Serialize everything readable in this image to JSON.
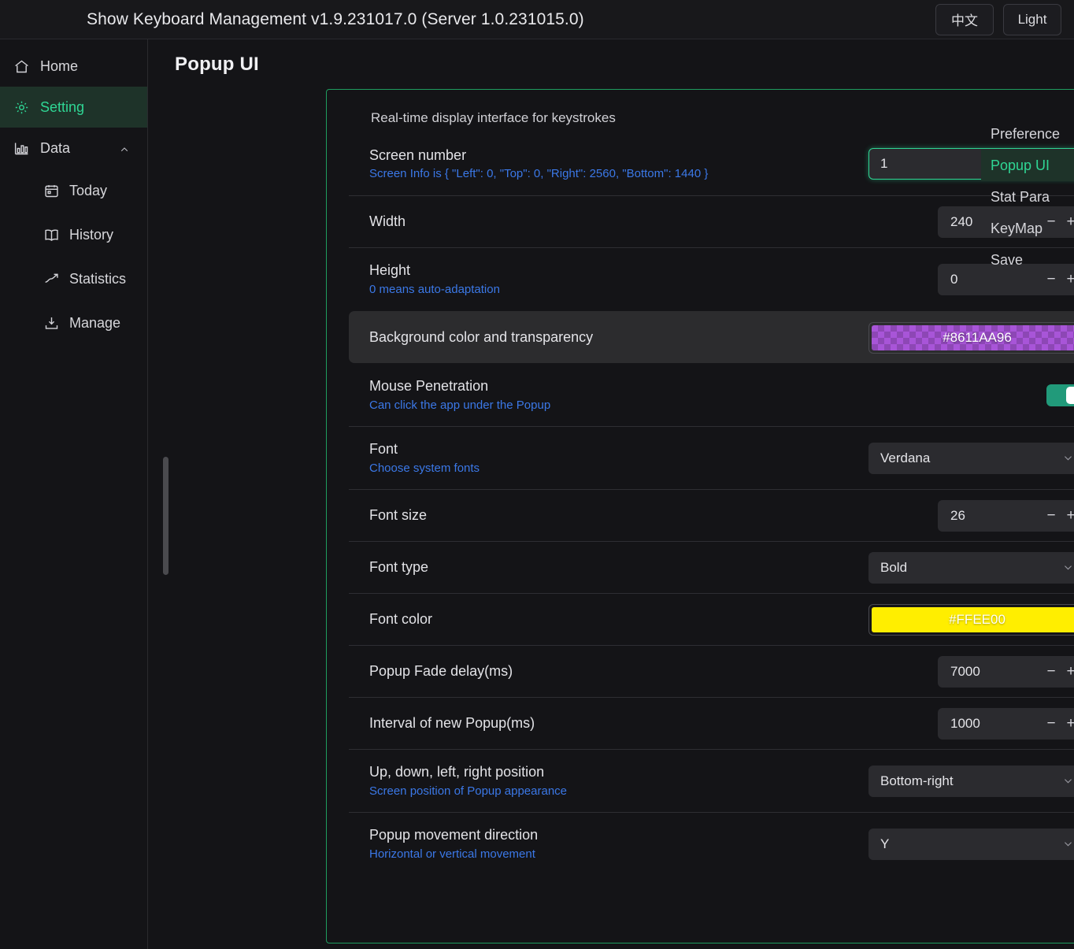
{
  "topbar": {
    "title": "Show Keyboard Management v1.9.231017.0 (Server 1.0.231015.0)",
    "lang_button": "中文",
    "theme_button": "Light"
  },
  "sidebar": {
    "items": [
      {
        "label": "Home",
        "icon": "home-icon",
        "active": false
      },
      {
        "label": "Setting",
        "icon": "gear-icon",
        "active": true
      },
      {
        "label": "Data",
        "icon": "bar-chart-icon",
        "active": false,
        "expanded": true
      },
      {
        "label": "Today",
        "icon": "calendar-icon",
        "sub": true
      },
      {
        "label": "History",
        "icon": "book-icon",
        "sub": true
      },
      {
        "label": "Statistics",
        "icon": "trend-up-icon",
        "sub": true
      },
      {
        "label": "Manage",
        "icon": "download-box-icon",
        "sub": true
      }
    ]
  },
  "rightnav": {
    "items": [
      {
        "label": "Preference",
        "active": false
      },
      {
        "label": "Popup UI",
        "active": true
      },
      {
        "label": "Stat Para",
        "active": false
      },
      {
        "label": "KeyMap",
        "active": false
      },
      {
        "label": "Save",
        "active": false
      }
    ]
  },
  "main": {
    "page_title": "Popup UI",
    "card_subtitle": "Real-time display interface for keystrokes",
    "rows": [
      {
        "name": "screen-number",
        "label": "Screen number",
        "hint": "Screen Info is { \"Left\": 0, \"Top\": 0, \"Right\": 2560, \"Bottom\": 1440 }",
        "control": "select",
        "value": "1",
        "focused": true
      },
      {
        "name": "width",
        "label": "Width",
        "hint": "",
        "control": "stepper",
        "value": "240"
      },
      {
        "name": "height",
        "label": "Height",
        "hint": "0 means auto-adaptation",
        "control": "stepper",
        "value": "0"
      },
      {
        "name": "background-color",
        "label": "Background color and transparency",
        "hint": "",
        "control": "color",
        "value": "#8611AA96",
        "swatch_color": "#a855d8",
        "highlight": true
      },
      {
        "name": "mouse-penetration",
        "label": "Mouse Penetration",
        "hint": "Can click the app under the Popup",
        "control": "toggle",
        "value": "on"
      },
      {
        "name": "font",
        "label": "Font",
        "hint": "Choose system fonts",
        "control": "select",
        "value": "Verdana"
      },
      {
        "name": "font-size",
        "label": "Font size",
        "hint": "",
        "control": "stepper",
        "value": "26"
      },
      {
        "name": "font-type",
        "label": "Font type",
        "hint": "",
        "control": "select",
        "value": "Bold"
      },
      {
        "name": "font-color",
        "label": "Font color",
        "hint": "",
        "control": "color",
        "value": "#FFEE00",
        "swatch_color": "#ffee00"
      },
      {
        "name": "popup-fade-delay",
        "label": "Popup Fade delay(ms)",
        "hint": "",
        "control": "stepper",
        "value": "7000"
      },
      {
        "name": "popup-interval",
        "label": "Interval of new Popup(ms)",
        "hint": "",
        "control": "stepper",
        "value": "1000"
      },
      {
        "name": "popup-position",
        "label": "Up, down, left, right position",
        "hint": "Screen position of Popup appearance",
        "control": "select",
        "value": "Bottom-right"
      },
      {
        "name": "popup-movement-direction",
        "label": "Popup movement direction",
        "hint": "Horizontal or vertical movement",
        "control": "select",
        "value": "Y"
      }
    ]
  },
  "theme": {
    "accent_green": "#2fd694",
    "card_border": "#1f9d5f",
    "hint_blue": "#3b78e7",
    "toggle_on": "#219a7a"
  }
}
